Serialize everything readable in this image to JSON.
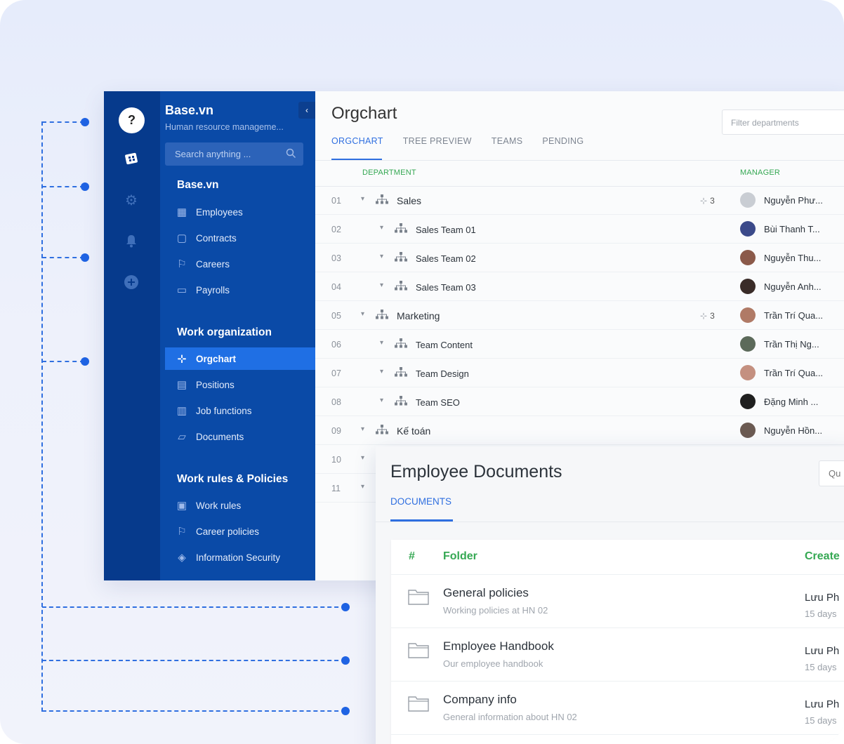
{
  "sidebar": {
    "brand": "Base.vn",
    "subtitle": "Human resource manageme...",
    "search_placeholder": "Search anything ...",
    "sections": [
      {
        "title": "Base.vn",
        "items": [
          "Employees",
          "Contracts",
          "Careers",
          "Payrolls"
        ]
      },
      {
        "title": "Work organization",
        "items": [
          "Orgchart",
          "Positions",
          "Job functions",
          "Documents"
        ]
      },
      {
        "title": "Work rules & Policies",
        "items": [
          "Work rules",
          "Career policies",
          "Information Security"
        ]
      }
    ],
    "active_item": "Orgchart"
  },
  "orgchart": {
    "title": "Orgchart",
    "filter_placeholder": "Filter departments",
    "tabs": [
      "ORGCHART",
      "TREE PREVIEW",
      "TEAMS",
      "PENDING"
    ],
    "active_tab": "ORGCHART",
    "columns": {
      "department": "DEPARTMENT",
      "manager": "MANAGER"
    },
    "rows": [
      {
        "num": "01",
        "name": "Sales",
        "level": 0,
        "count": "3",
        "manager": "Nguyễn Phư..."
      },
      {
        "num": "02",
        "name": "Sales Team 01",
        "level": 1,
        "count": "",
        "manager": "Bùi Thanh T..."
      },
      {
        "num": "03",
        "name": "Sales Team 02",
        "level": 1,
        "count": "",
        "manager": "Nguyễn Thu..."
      },
      {
        "num": "04",
        "name": "Sales Team 03",
        "level": 1,
        "count": "",
        "manager": "Nguyễn Anh..."
      },
      {
        "num": "05",
        "name": "Marketing",
        "level": 0,
        "count": "3",
        "manager": "Trần Trí Qua..."
      },
      {
        "num": "06",
        "name": "Team Content",
        "level": 1,
        "count": "",
        "manager": "Trần Thị Ng..."
      },
      {
        "num": "07",
        "name": "Team Design",
        "level": 1,
        "count": "",
        "manager": "Trần Trí Qua..."
      },
      {
        "num": "08",
        "name": "Team SEO",
        "level": 1,
        "count": "",
        "manager": "Đặng Minh ..."
      },
      {
        "num": "09",
        "name": "Kế toán",
        "level": 0,
        "count": "",
        "manager": "Nguyễn Hồn..."
      },
      {
        "num": "10",
        "name": "",
        "level": 0,
        "count": "",
        "manager": ""
      },
      {
        "num": "11",
        "name": "",
        "level": 0,
        "count": "",
        "manager": ""
      }
    ]
  },
  "documents": {
    "title": "Employee Documents",
    "button_label": "Qu",
    "tab": "DOCUMENTS",
    "columns": {
      "num": "#",
      "folder": "Folder",
      "created": "Create"
    },
    "rows": [
      {
        "name": "General policies",
        "desc": "Working policies at HN 02",
        "created_by": "Lưu Ph",
        "created_ago": "15 days"
      },
      {
        "name": "Employee Handbook",
        "desc": "Our employee handbook",
        "created_by": "Lưu Ph",
        "created_ago": "15 days"
      },
      {
        "name": "Company info",
        "desc": "General information about HN 02",
        "created_by": "Lưu Ph",
        "created_ago": "15 days"
      }
    ]
  },
  "colors": {
    "icon_rail": "#063a8c",
    "sidebar": "#0a4aa7",
    "accent": "#2f6fe0",
    "active_item": "#1f6fe4",
    "column_header": "#35a853"
  }
}
